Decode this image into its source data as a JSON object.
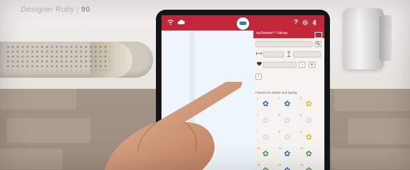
{
  "machine": {
    "brand_name": "Designer Ruby",
    "model_number": "90"
  },
  "screen": {
    "top_icons": [
      "wifi-icon",
      "cloud-icon",
      "home-icon",
      "help-icon",
      "gear-icon",
      "bluetooth-icon"
    ],
    "help_label": "?",
    "library_panel": {
      "title": "mySewnet™ Library",
      "search_placeholder": "",
      "section_label": "Flowers for Easter and Spring",
      "items": [
        {
          "num": "1",
          "icon": "blue-flower",
          "color": "#2a66c4"
        },
        {
          "num": "2",
          "icon": "blue-flower",
          "color": "#2a66c4"
        },
        {
          "num": "3",
          "icon": "yellow-flower",
          "color": "#e2b822"
        },
        {
          "num": "4",
          "icon": "white-flower",
          "color": "#d9d6cf"
        },
        {
          "num": "5",
          "icon": "white-flower",
          "color": "#d9d6cf"
        },
        {
          "num": "6",
          "icon": "white-flower",
          "color": "#d9d6cf"
        },
        {
          "num": "7",
          "icon": "white-flower",
          "color": "#d9d6cf"
        },
        {
          "num": "8",
          "icon": "white-flower",
          "color": "#d9d6cf"
        },
        {
          "num": "9",
          "icon": "yellow-flower",
          "color": "#e2b822"
        },
        {
          "num": "10",
          "icon": "green-flower",
          "color": "#3f9a3a"
        },
        {
          "num": "11",
          "icon": "blue-flower",
          "color": "#2a66c4"
        },
        {
          "num": "12",
          "icon": "green-flower",
          "color": "#3f9a3a"
        },
        {
          "num": "13",
          "icon": "green-flower",
          "color": "#3f9a3a"
        },
        {
          "num": "14",
          "icon": "blue-flower",
          "color": "#2a66c4"
        },
        {
          "num": "15",
          "icon": "green-flower",
          "color": "#3f9a3a"
        }
      ]
    }
  },
  "colors": {
    "accent_red": "#c2283a",
    "panel_bg": "#f5f3ef",
    "canvas_bg": "#eef5fb"
  }
}
